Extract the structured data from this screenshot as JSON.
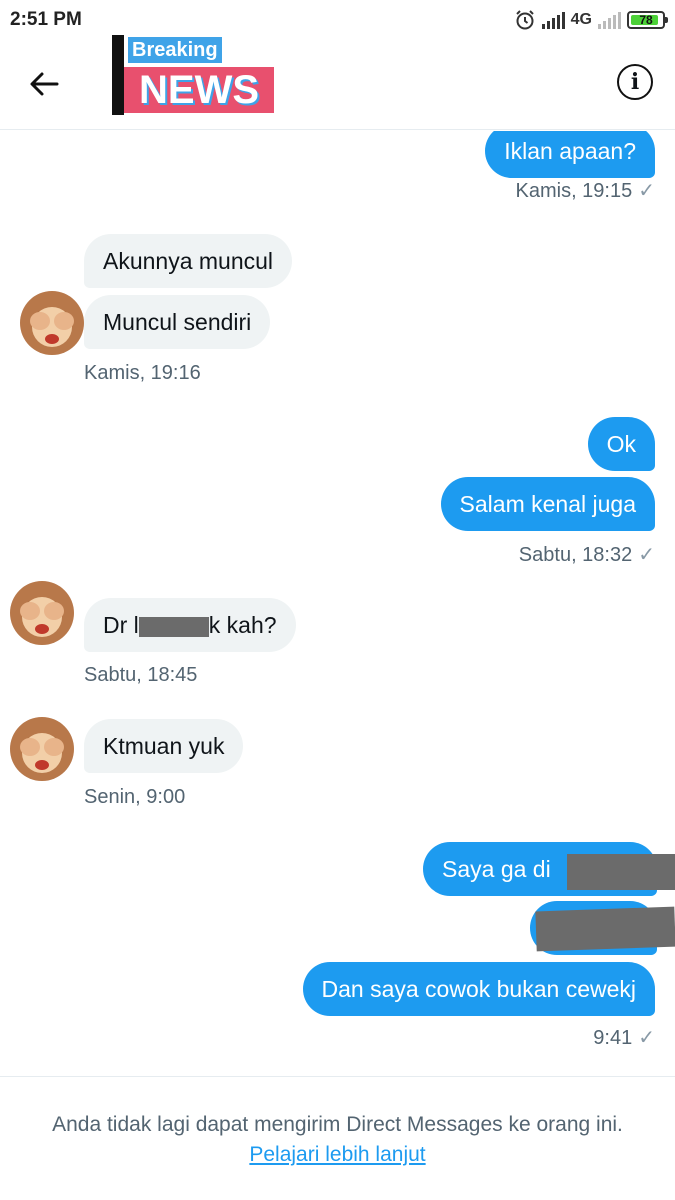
{
  "status_bar": {
    "time": "2:51 PM",
    "network": "4G",
    "battery": "78"
  },
  "header": {
    "logo_top": "Breaking",
    "logo_bottom": "NEWS"
  },
  "messages": [
    {
      "text": "Iklan apaan?",
      "direction": "sent"
    },
    {
      "text": "Kamis, 19:15",
      "kind": "timestamp"
    },
    {
      "text": "Akunnya muncul",
      "direction": "received"
    },
    {
      "text": "Muncul sendiri",
      "direction": "received"
    },
    {
      "text": "Kamis, 19:16",
      "kind": "timestamp"
    },
    {
      "text": "Ok",
      "direction": "sent"
    },
    {
      "text": "Salam kenal juga",
      "direction": "sent"
    },
    {
      "text": "Sabtu, 18:32",
      "kind": "timestamp"
    },
    {
      "text_before": "Dr l",
      "text_after": "k kah?",
      "direction": "received"
    },
    {
      "text": "Sabtu, 18:45",
      "kind": "timestamp"
    },
    {
      "text": "Ktmuan yuk",
      "direction": "received"
    },
    {
      "text": "Senin, 9:00",
      "kind": "timestamp"
    },
    {
      "text": "Saya ga di",
      "direction": "sent"
    },
    {
      "text": "",
      "direction": "sent"
    },
    {
      "text": "Dan saya cowok bukan cewekj",
      "direction": "sent"
    },
    {
      "text": "9:41",
      "kind": "timestamp"
    }
  ],
  "footer": {
    "notice": "Anda tidak lagi dapat mengirim Direct Messages ke orang ini.",
    "link": "Pelajari lebih lanjut"
  },
  "icons": [
    "back-arrow-icon",
    "info-icon",
    "alarm-icon",
    "signal-icon",
    "battery-icon",
    "check-icon"
  ],
  "colors": {
    "sent_bubble": "#1d9bf0",
    "received_bubble": "#eff3f4",
    "meta_text": "#536471",
    "link": "#1d9bf0"
  }
}
